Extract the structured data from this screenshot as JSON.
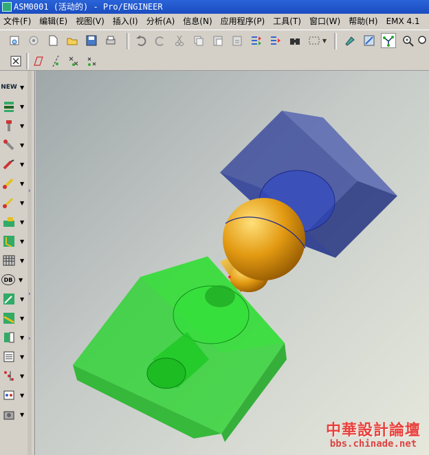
{
  "window": {
    "title": "ASM0001 (活动的) - Pro/ENGINEER"
  },
  "menu": [
    {
      "label": "文件(F)"
    },
    {
      "label": "编辑(E)"
    },
    {
      "label": "视图(V)"
    },
    {
      "label": "插入(I)"
    },
    {
      "label": "分析(A)"
    },
    {
      "label": "信息(N)"
    },
    {
      "label": "应用程序(P)"
    },
    {
      "label": "工具(T)"
    },
    {
      "label": "窗口(W)"
    },
    {
      "label": "帮助(H)"
    },
    {
      "label": "EMX 4.1"
    }
  ],
  "toolbar_icons": [
    "new-window-icon",
    "open-remote-icon",
    "new-file-icon",
    "open-folder-icon",
    "save-icon",
    "print-icon",
    "undo-icon",
    "redo-icon",
    "cut-icon",
    "copy-icon",
    "paste-icon",
    "paste-special-icon",
    "regenerate-icon",
    "regen-manager-icon",
    "find-icon",
    "select-box-icon",
    "repaint-icon",
    "orient-icon",
    "datum-display-icon",
    "zoom-in-icon"
  ],
  "toolbar2_icons": [
    "close-window-icon",
    "plane-icon",
    "axis-display-icon",
    "point-display-icon",
    "csys-display-icon"
  ],
  "left_tools": [
    {
      "name": "new-assembly-icon",
      "text": "NEW"
    },
    {
      "name": "base-plate-icon",
      "text": ""
    },
    {
      "name": "guide-pin-icon",
      "text": ""
    },
    {
      "name": "screw-icon",
      "text": ""
    },
    {
      "name": "dowel-icon",
      "text": ""
    },
    {
      "name": "ejector-icon",
      "text": ""
    },
    {
      "name": "sleeve-icon",
      "text": ""
    },
    {
      "name": "slider-icon",
      "text": ""
    },
    {
      "name": "lifter-icon",
      "text": ""
    },
    {
      "name": "plate-stack-icon",
      "text": ""
    },
    {
      "name": "database-icon",
      "text": "DB"
    },
    {
      "name": "analysis-icon",
      "text": ""
    },
    {
      "name": "cooling-icon",
      "text": ""
    },
    {
      "name": "bom-icon",
      "text": ""
    },
    {
      "name": "drawing-icon",
      "text": ""
    },
    {
      "name": "pattern-icon",
      "text": ""
    },
    {
      "name": "settings-icon",
      "text": ""
    },
    {
      "name": "tools-icon",
      "text": ""
    }
  ],
  "watermark": {
    "text_cn": "中華設計論壇",
    "url": "bbs.chinade.net"
  },
  "colors": {
    "title_bar": "#1a4cc0",
    "chrome": "#d4d0c8",
    "green_part": "#2fd63a",
    "blue_part": "#3a4aa0",
    "gold_part": "#e09a10"
  }
}
